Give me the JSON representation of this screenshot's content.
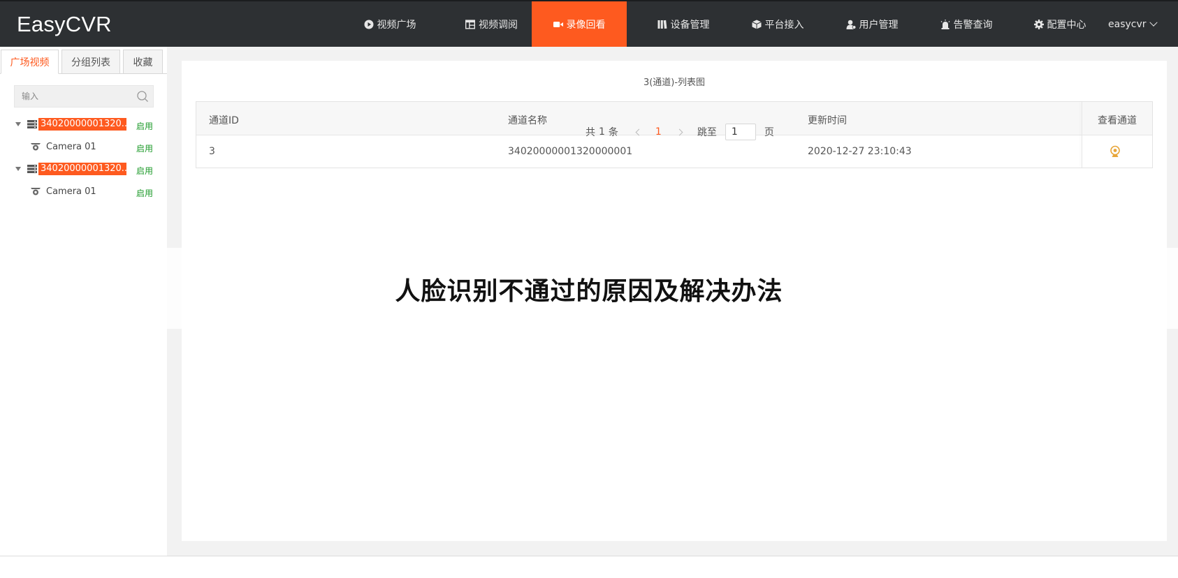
{
  "app": {
    "title": "EasyCVR"
  },
  "nav": [
    {
      "label": "视频广场",
      "icon": "play-circle-icon"
    },
    {
      "label": "视频调阅",
      "icon": "grid-layout-icon"
    },
    {
      "label": "录像回看",
      "icon": "video-camera-icon",
      "active": true
    },
    {
      "label": "设备管理",
      "icon": "books-icon"
    },
    {
      "label": "平台接入",
      "icon": "cube-icon"
    },
    {
      "label": "用户管理",
      "icon": "user-icon"
    },
    {
      "label": "告警查询",
      "icon": "alarm-light-icon"
    },
    {
      "label": "配置中心",
      "icon": "gear-icon"
    }
  ],
  "user": {
    "name": "easycvr"
  },
  "sidebar": {
    "tabs": [
      {
        "label": "广场视频",
        "active": true
      },
      {
        "label": "分组列表"
      },
      {
        "label": "收藏"
      }
    ],
    "search": {
      "placeholder": "输入"
    },
    "tree": [
      {
        "label": "34020000001320...",
        "status": "启用",
        "children": [
          {
            "label": "Camera 01",
            "status": "启用"
          }
        ]
      },
      {
        "label": "34020000001320...",
        "status": "启用",
        "children": [
          {
            "label": "Camera 01",
            "status": "启用"
          }
        ]
      }
    ]
  },
  "main": {
    "title": "3(通道)-列表图",
    "table": {
      "columns": [
        "通道ID",
        "通道名称",
        "更新时间",
        "查看通道"
      ],
      "rows": [
        {
          "id": "3",
          "name": "34020000001320000001",
          "updated": "2020-12-27 23:10:43"
        }
      ]
    },
    "pagination": {
      "total_prefix": "共",
      "total": "1",
      "total_suffix": "条",
      "current": "1",
      "jump_label": "跳至",
      "jump_value": "1",
      "page_suffix": "页"
    }
  },
  "overlay": {
    "caption": "人脸识别不通过的原因及解决办法"
  },
  "colors": {
    "accent": "#fe5a1f",
    "topbar": "#2d3033",
    "enabled": "#1d9a2a"
  }
}
